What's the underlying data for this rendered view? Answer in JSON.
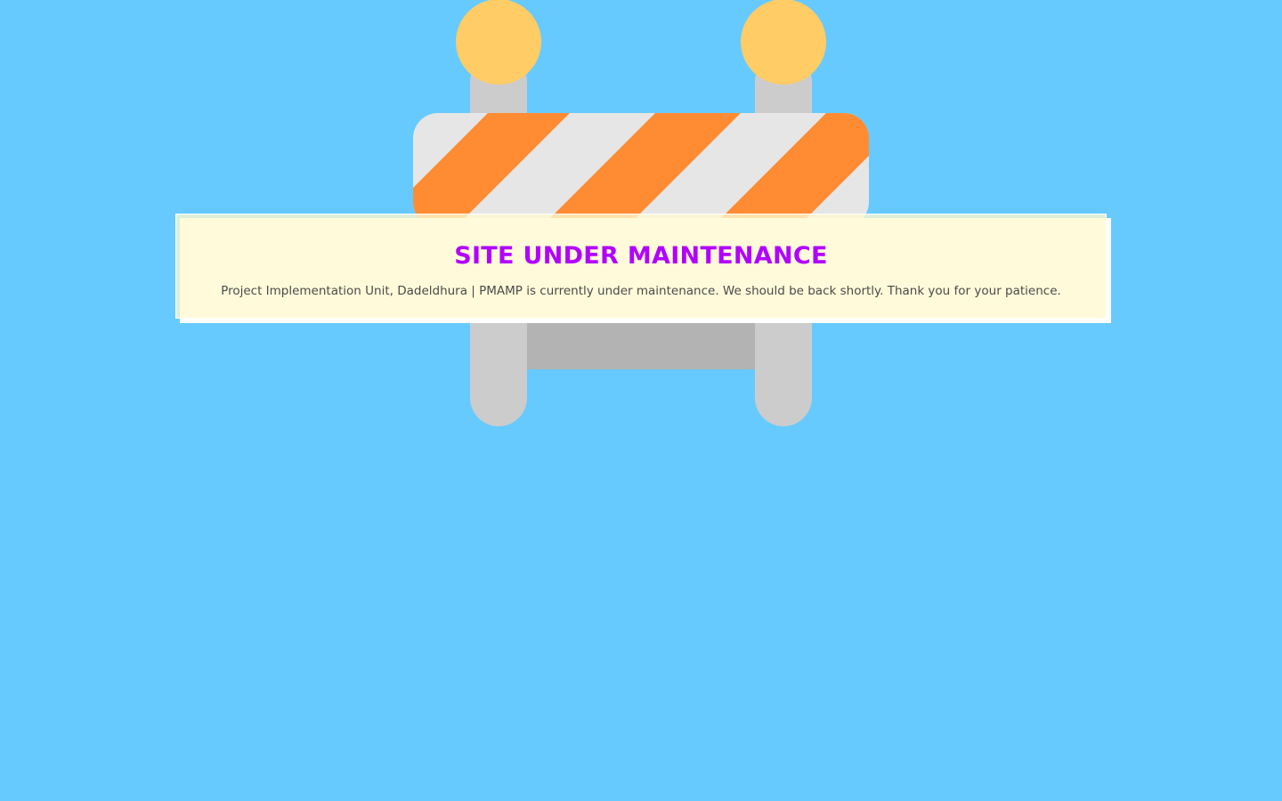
{
  "page": {
    "background_color": "#66caff"
  },
  "barrier": {
    "icon": "road-barrier-icon",
    "colors": {
      "lamp": "#ffcc66",
      "post": "#cccccc",
      "crossbar": "#b3b3b3",
      "stripe_orange": "#ff8c33",
      "stripe_white": "#e6e6e6"
    }
  },
  "notice": {
    "title": "SITE UNDER MAINTENANCE",
    "message": "Project Implementation Unit, Dadeldhura | PMAMP is currently under maintenance. We should be back shortly. Thank you for your patience.",
    "title_color": "#b200ff"
  }
}
